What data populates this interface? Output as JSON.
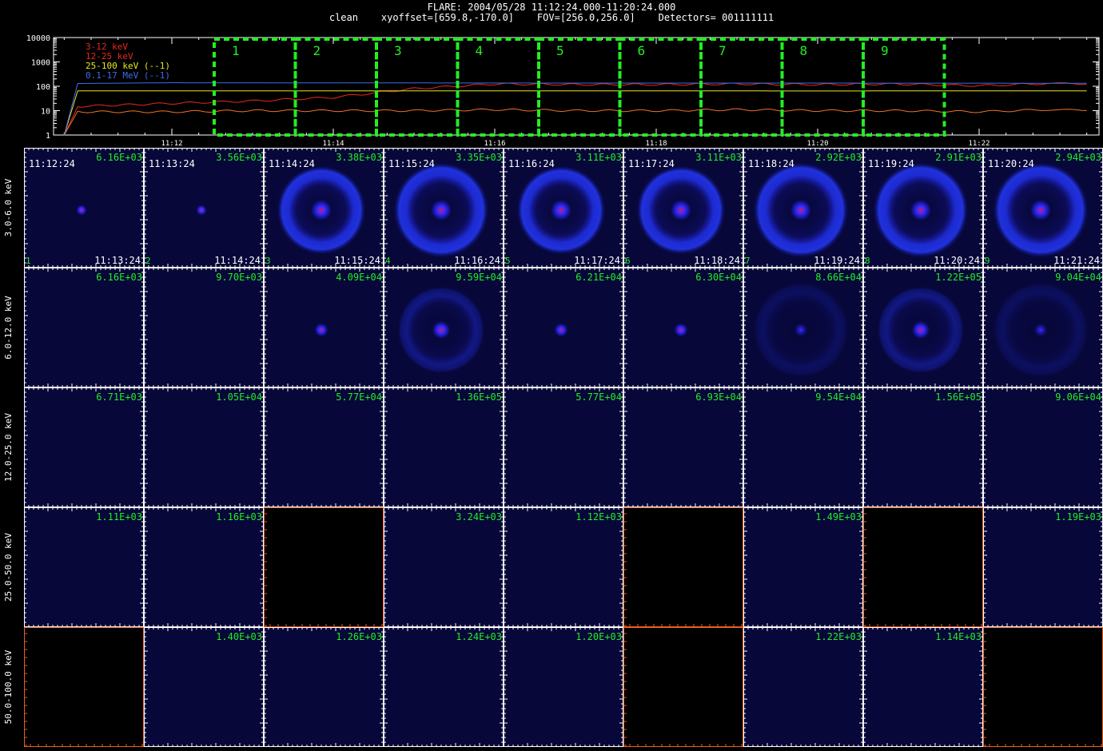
{
  "header": {
    "line1": "FLARE: 2004/05/28 11:12:24.000-11:20:24.000",
    "line2": "clean    xyoffset=[659.8,-170.0]    FOV=[256.0,256.0]    Detectors= 001111111"
  },
  "lightcurve": {
    "legend": [
      {
        "label": "3-12 keV",
        "color": "#e8281e"
      },
      {
        "label": "12-25 keV",
        "color": "#e8281e"
      },
      {
        "label": "25-100 keV (--1)",
        "color": "#e6e626"
      },
      {
        "label": "0.1-17 MeV (--1)",
        "color": "#3a6ee8"
      }
    ],
    "y_ticks": [
      "10000",
      "1000",
      "100",
      "10",
      "1"
    ],
    "x_ticks": [
      "11:12",
      "11:14",
      "11:16",
      "11:18",
      "11:20",
      "11:22"
    ],
    "boxes": [
      "1",
      "2",
      "3",
      "4",
      "5",
      "6",
      "7",
      "8",
      "9"
    ],
    "box_color": "#22ee22",
    "chart_data": {
      "type": "line",
      "xlabel": "",
      "ylabel": "",
      "yscale": "log",
      "ylim": [
        1,
        10000
      ],
      "x_unit": "UT time",
      "series": [
        {
          "name": "3-12 keV",
          "color": "#e8281e",
          "x": [
            "11:10:40",
            "11:10:50",
            "11:12:00",
            "11:13:00",
            "11:14:00",
            "11:15:00",
            "11:16:00",
            "11:17:00",
            "11:18:00",
            "11:19:00",
            "11:20:00",
            "11:21:00",
            "11:22:00",
            "11:22:50",
            "11:23:20"
          ],
          "y": [
            1,
            15,
            20,
            25,
            35,
            80,
            125,
            118,
            118,
            125,
            118,
            125,
            105,
            130,
            125
          ]
        },
        {
          "name": "12-25 keV",
          "color": "#f07028",
          "x": [
            "11:10:40",
            "11:10:50",
            "11:12:00",
            "11:13:00",
            "11:14:00",
            "11:15:00",
            "11:16:00",
            "11:17:00",
            "11:18:00",
            "11:19:00",
            "11:20:00",
            "11:21:00",
            "11:22:00",
            "11:22:50",
            "11:23:20"
          ],
          "y": [
            1,
            9,
            9,
            10,
            10,
            10,
            11,
            10,
            10,
            11,
            10,
            10,
            9,
            11,
            10
          ]
        },
        {
          "name": "25-100 keV (--1)",
          "color": "#e6e626",
          "x": [
            "11:10:40",
            "11:10:50",
            "11:12:00",
            "11:14:00",
            "11:16:00",
            "11:18:00",
            "11:20:00",
            "11:22:00",
            "11:23:20"
          ],
          "y": [
            1,
            65,
            65,
            65,
            65,
            65,
            64,
            65,
            65
          ]
        },
        {
          "name": "0.1-17 MeV (--1)",
          "color": "#3a6ee8",
          "x": [
            "11:10:40",
            "11:10:50",
            "11:12:00",
            "11:14:00",
            "11:16:00",
            "11:18:00",
            "11:20:00",
            "11:22:00",
            "11:23:20"
          ],
          "y": [
            1,
            130,
            140,
            138,
            136,
            135,
            135,
            134,
            133
          ]
        }
      ]
    }
  },
  "grid": {
    "bands": [
      "3.0-6.0 keV",
      "6.0-12.0 keV",
      "12.0-25.0 keV",
      "25.0-50.0 keV",
      "50.0-100.0 keV"
    ],
    "rows": [
      {
        "band": "3.0-6.0 keV",
        "panels": [
          {
            "max": "6.16E+03",
            "start": "11:12:24",
            "end": "11:13:24",
            "idx": "1",
            "img": "dot"
          },
          {
            "max": "3.56E+03",
            "start": "11:13:24",
            "end": "11:14:24",
            "idx": "2",
            "img": "dot"
          },
          {
            "max": "3.38E+03",
            "start": "11:14:24",
            "end": "11:15:24",
            "idx": "3",
            "img": "ring"
          },
          {
            "max": "3.35E+03",
            "start": "11:15:24",
            "end": "11:16:24",
            "idx": "4",
            "img": "ringbig"
          },
          {
            "max": "3.11E+03",
            "start": "11:16:24",
            "end": "11:17:24",
            "idx": "5",
            "img": "ring"
          },
          {
            "max": "3.11E+03",
            "start": "11:17:24",
            "end": "11:18:24",
            "idx": "6",
            "img": "ring"
          },
          {
            "max": "2.92E+03",
            "start": "11:18:24",
            "end": "11:19:24",
            "idx": "7",
            "img": "ringbig"
          },
          {
            "max": "2.91E+03",
            "start": "11:19:24",
            "end": "11:20:24",
            "idx": "8",
            "img": "ringbig"
          },
          {
            "max": "2.94E+03",
            "start": "11:20:24",
            "end": "11:21:24",
            "idx": "9",
            "img": "ringbig"
          }
        ]
      },
      {
        "band": "6.0-12.0 keV",
        "panels": [
          {
            "max": "6.16E+03",
            "img": "none"
          },
          {
            "max": "9.70E+03",
            "img": "none"
          },
          {
            "max": "4.09E+04",
            "img": "dot"
          },
          {
            "max": "9.59E+04",
            "img": "ringfaint"
          },
          {
            "max": "6.21E+04",
            "img": "dot"
          },
          {
            "max": "6.30E+04",
            "img": "dot"
          },
          {
            "max": "8.66E+04",
            "img": "dotfaint"
          },
          {
            "max": "1.22E+05",
            "img": "ringfaint"
          },
          {
            "max": "9.04E+04",
            "img": "dotfaint"
          }
        ]
      },
      {
        "band": "12.0-25.0 keV",
        "panels": [
          {
            "max": "6.71E+03"
          },
          {
            "max": "1.05E+04"
          },
          {
            "max": "5.77E+04"
          },
          {
            "max": "1.36E+05"
          },
          {
            "max": "5.77E+04"
          },
          {
            "max": "6.93E+04"
          },
          {
            "max": "9.54E+04"
          },
          {
            "max": "1.56E+05"
          },
          {
            "max": "9.06E+04"
          }
        ]
      },
      {
        "band": "25.0-50.0 keV",
        "panels": [
          {
            "max": "1.11E+03"
          },
          {
            "max": "1.16E+03"
          },
          {
            "max": "",
            "empty": true
          },
          {
            "max": "3.24E+03"
          },
          {
            "max": "1.12E+03"
          },
          {
            "max": "",
            "empty": true
          },
          {
            "max": "1.49E+03"
          },
          {
            "max": "",
            "empty": true
          },
          {
            "max": "1.19E+03"
          }
        ]
      },
      {
        "band": "50.0-100.0 keV",
        "panels": [
          {
            "max": "",
            "empty": true
          },
          {
            "max": "1.40E+03"
          },
          {
            "max": "1.26E+03"
          },
          {
            "max": "1.24E+03"
          },
          {
            "max": "1.20E+03"
          },
          {
            "max": "",
            "empty": true
          },
          {
            "max": "1.22E+03"
          },
          {
            "max": "1.14E+03"
          },
          {
            "max": "",
            "empty": true
          }
        ]
      }
    ],
    "empty_axis_ticks": [
      "2",
      "4",
      "6",
      "8"
    ]
  }
}
